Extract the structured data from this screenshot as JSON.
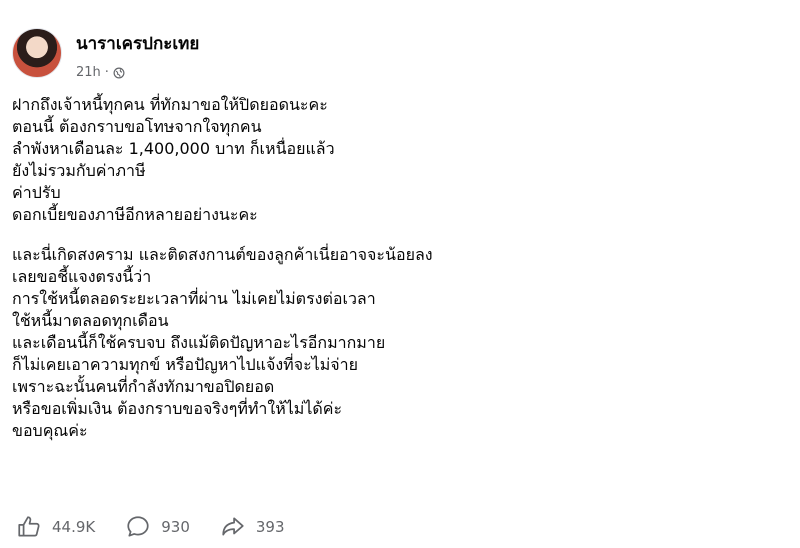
{
  "post": {
    "author": "นาราเครปกะเทย",
    "time": "21h",
    "separator": "·",
    "privacy_icon": "globe-icon",
    "lines": [
      "ฝากถึงเจ้าหนี้ทุกคน ที่ทักมาขอให้ปิดยอดนะคะ",
      "ตอนนี้ ต้องกราบขอโทษจากใจทุกคน",
      "ลำพังหาเดือนละ 1,400,000 บาท ก็เหนื่อยแล้ว",
      "ยังไม่รวมกับค่าภาษี",
      "ค่าปรับ",
      "ดอกเบี้ยของภาษีอีกหลายอย่างนะคะ",
      "และนี่เกิดสงคราม และติดสงกานต์ของลูกค้าเนี่ยอาจจะน้อยลง",
      "เลยขอชี้แจงตรงนี้ว่า",
      "การใช้หนี้ตลอดระยะเวลาที่ผ่าน ไม่เคยไม่ตรงต่อเวลา",
      "ใช้หนี้มาตลอดทุกเดือน",
      "และเดือนนี้ก็ใช้ครบจบ ถึงแม้ติดปัญหาอะไรอีกมากมาย",
      "ก็ไม่เคยเอาความทุกข์ หรือปัญหาไปแจ้งที่จะไม่จ่าย",
      "เพราะฉะนั้นคนที่กำลังทักมาขอปิดยอด",
      "หรือขอเพิ่มเงิน ต้องกราบขอจริงๆที่ทำให้ไม่ได้ค่ะ",
      "ขอบคุณค่ะ"
    ]
  },
  "actions": {
    "like": {
      "icon": "thumbs-up-icon",
      "count": "44.9K"
    },
    "comment": {
      "icon": "comment-icon",
      "count": "930"
    },
    "share": {
      "icon": "share-icon",
      "count": "393"
    }
  }
}
